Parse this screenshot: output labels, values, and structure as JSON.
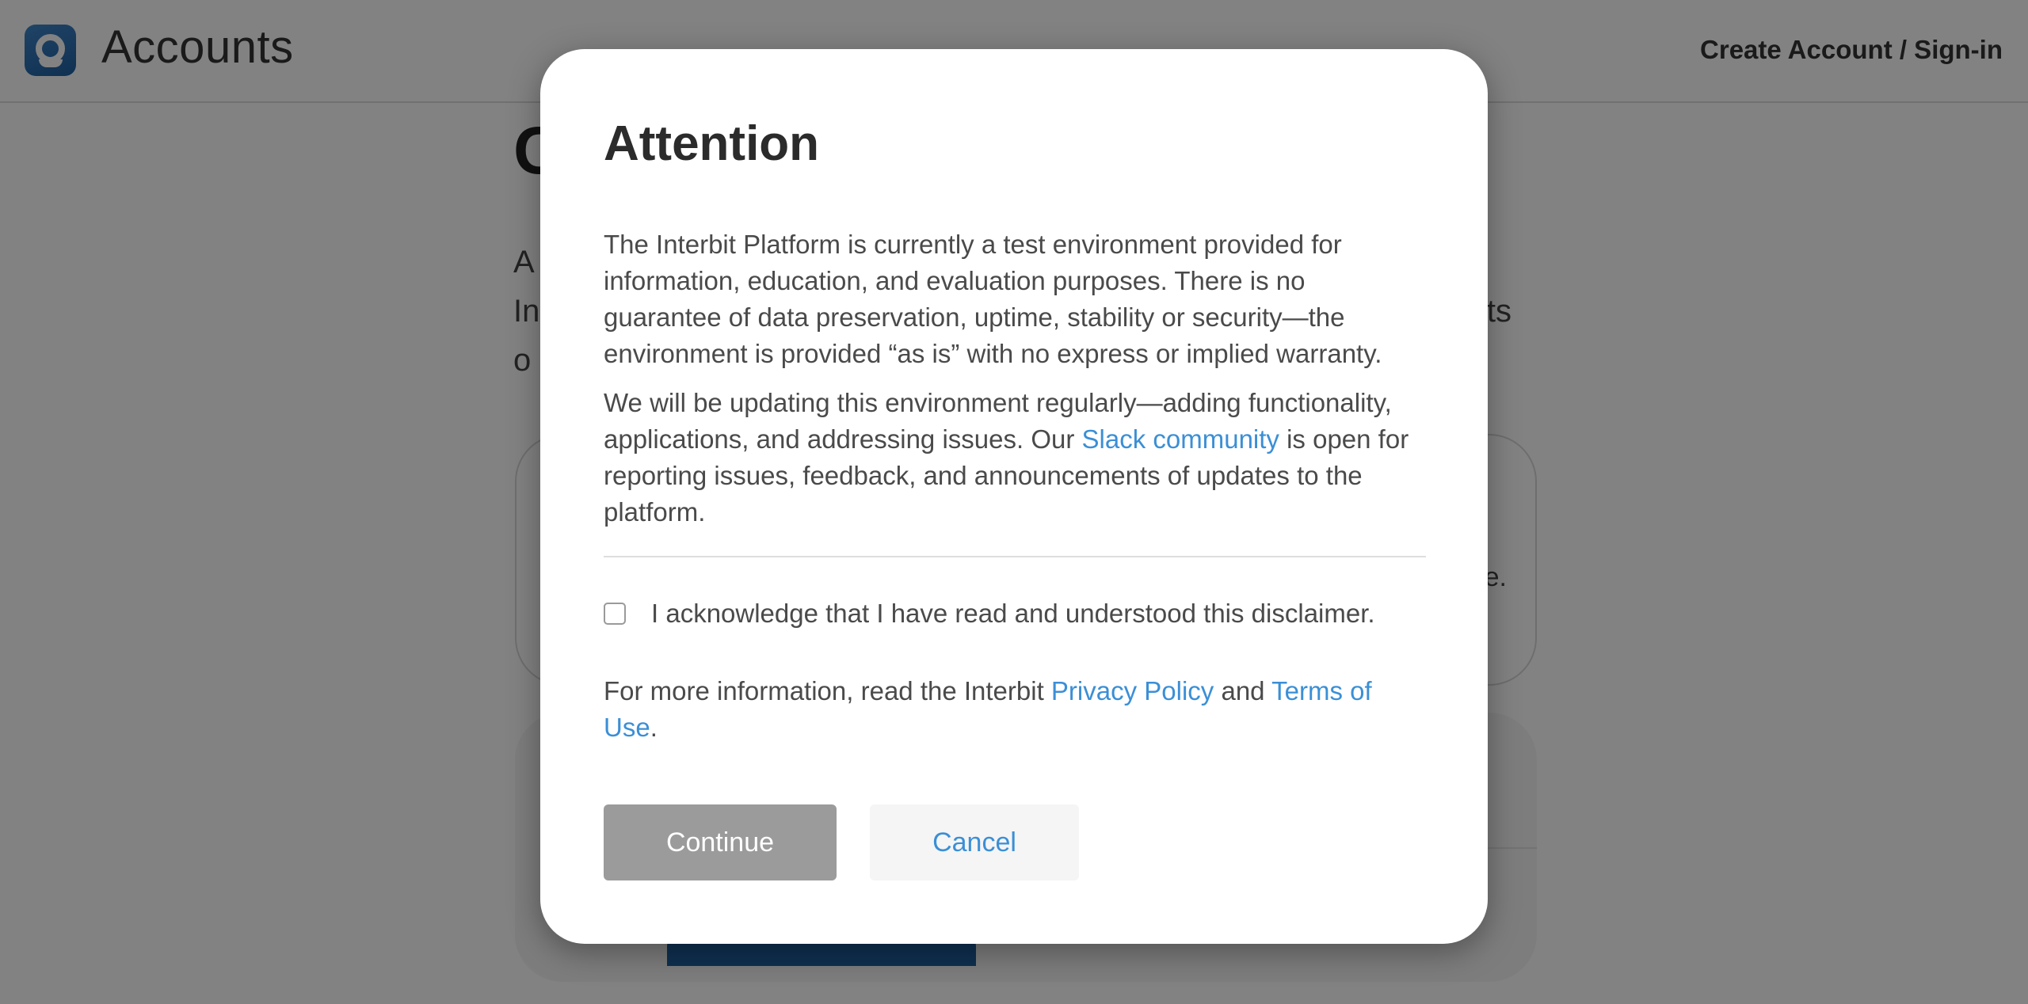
{
  "header": {
    "app_title": "Accounts",
    "account_link": "Create Account / Sign-in",
    "logo_icon": "interbit-logo-icon"
  },
  "background": {
    "heading_fragment": "C",
    "intro_line1": "A",
    "intro_line2": "In",
    "intro_line2_end": "ts",
    "intro_line3": "o",
    "card_text_fragment": "e."
  },
  "modal": {
    "title": "Attention",
    "para1": "The Interbit Platform is currently a test environment provided for information, education, and evaluation purposes. There is no guarantee of data preservation, uptime, stability or security—the environment is provided “as is” with no express or implied warranty.",
    "para2_before": "We will be updating this environment regularly—adding functionality, applications, and addressing issues. Our ",
    "para2_link": "Slack community",
    "para2_after": " is open for reporting issues, feedback, and announcements of updates to the platform.",
    "ack_label": "I acknowledge that I have read and understood this disclaimer.",
    "ack_checked": false,
    "info_before": "For more information, read the Interbit ",
    "privacy_link": "Privacy Policy",
    "info_and": " and ",
    "terms_link": "Terms of Use",
    "info_end": ".",
    "continue_label": "Continue",
    "cancel_label": "Cancel"
  },
  "colors": {
    "link": "#3b8fd6",
    "continue_disabled_bg": "#9b9b9b",
    "overlay": "rgba(0,0,0,0.49)",
    "brand": "#1f5fa0"
  }
}
